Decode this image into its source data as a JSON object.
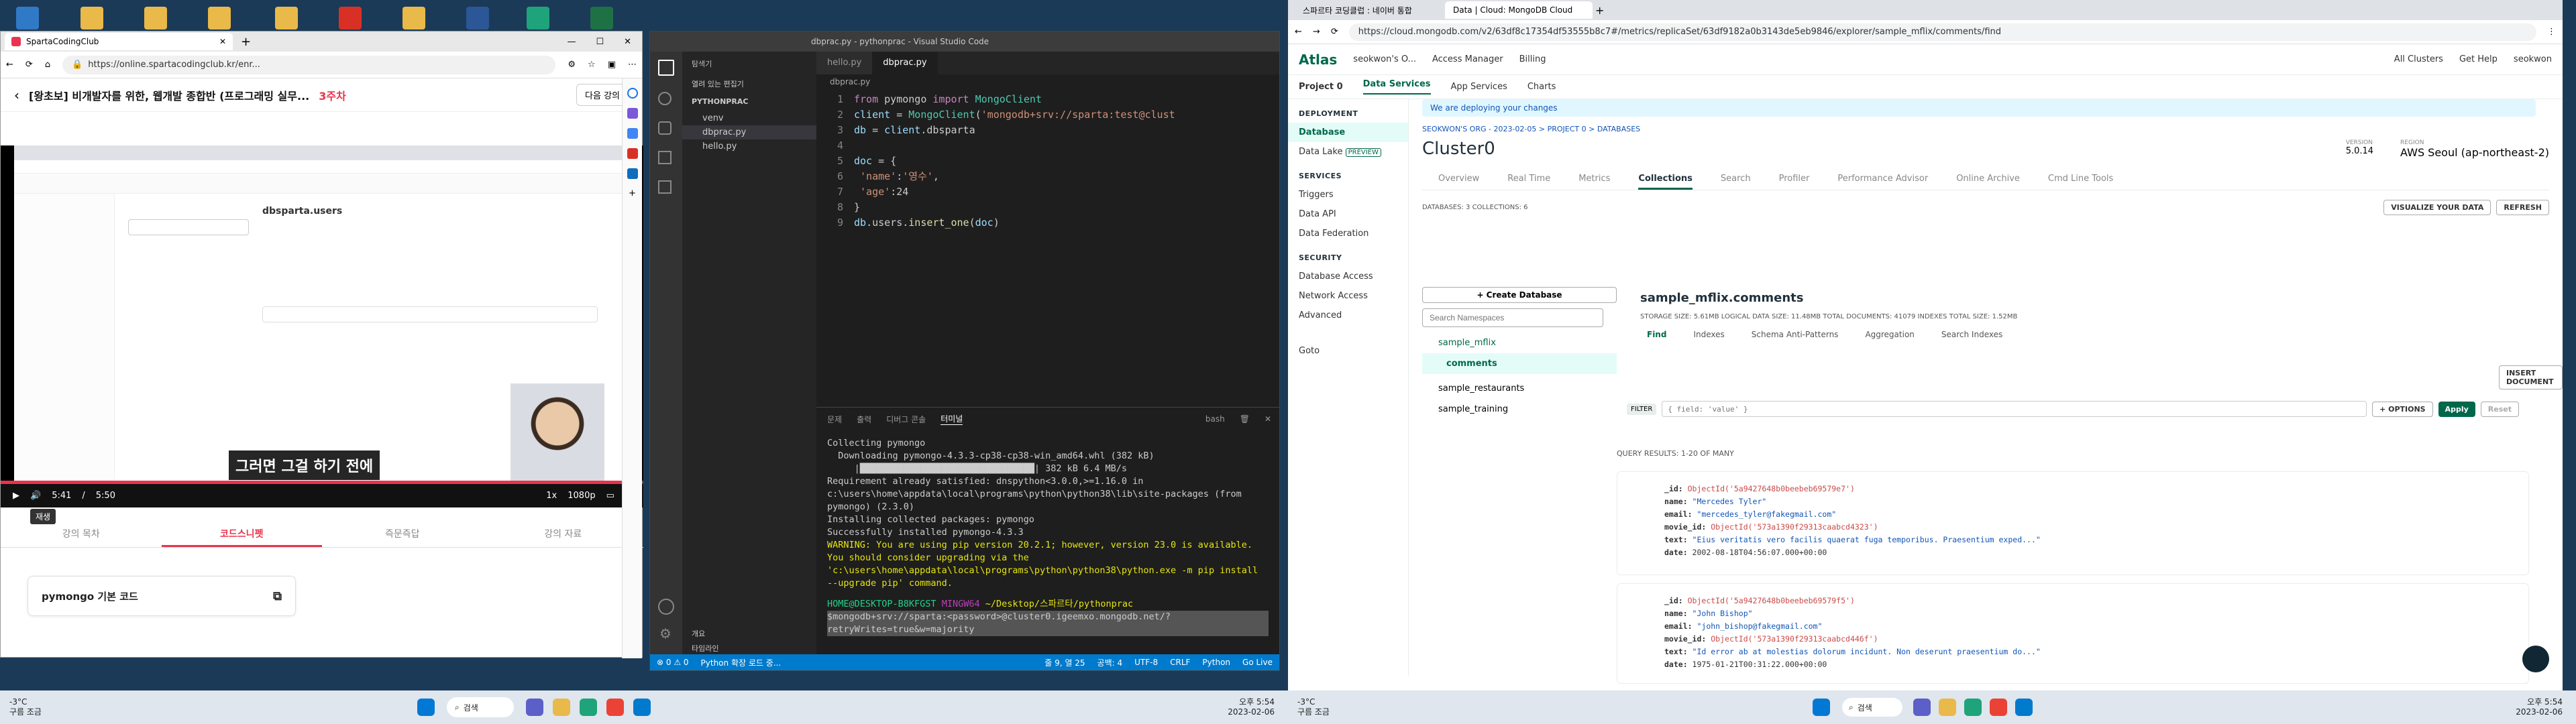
{
  "edge": {
    "tab_title": "SpartaCodingClub",
    "url": "https://online.spartacodingclub.kr/enr...",
    "lesson_title": "[왕초보] 비개발자를 위한, 웹개발 종합반 (프로그래밍 실무...",
    "lesson_week": "3주차",
    "next_lesson": "다음 강의",
    "subtitle": "그러면 그걸 하기 전에",
    "time_current": "5:41",
    "time_sep": "/",
    "time_total": "5:50",
    "speed": "1x",
    "quality": "1080p",
    "play_tooltip": "재생",
    "progress": 0.974,
    "lesson_tabs": [
      "강의 목차",
      "코드스니펫",
      "즉문즉답",
      "강의 자료"
    ],
    "snippet_title": "pymongo 기본 코드"
  },
  "vscode": {
    "title": "dbprac.py - pythonprac - Visual Studio Code",
    "explorer_label": "탐색기",
    "open_editors": "열려 있는 편집기",
    "project": "PYTHONPRAC",
    "files": [
      "venv",
      "dbprac.py",
      "hello.py"
    ],
    "outline": "개요",
    "timeline": "타임라인",
    "editor_tabs": [
      "hello.py",
      "dbprac.py"
    ],
    "breadcrumb": "dbprac.py",
    "code_lines": [
      "from pymongo import MongoClient",
      "client = MongoClient('mongodb+srv://sparta:test@clust",
      "db = client.dbsparta",
      "",
      "doc = {",
      "    'name':'영수',",
      "    'age':24",
      "}",
      "db.users.insert_one(doc)"
    ],
    "panel_tabs": [
      "문제",
      "출력",
      "디버그 콘솔",
      "터미널"
    ],
    "shell": "bash",
    "terminal": [
      "Collecting pymongo",
      "  Downloading pymongo-4.3.3-cp38-cp38-win_amd64.whl (382 kB)",
      "     |████████████████████████████████| 382 kB 6.4 MB/s",
      "Requirement already satisfied: dnspython<3.0.0,>=1.16.0 in c:\\users\\home\\appdata\\local\\programs\\python\\python38\\lib\\site-packages (from pymongo) (2.3.0)",
      "Installing collected packages: pymongo",
      "Successfully installed pymongo-4.3.3",
      "WARNING: You are using pip version 20.2.1; however, version 23.0 is available.",
      "You should consider upgrading via the 'c:\\users\\home\\appdata\\local\\programs\\python\\python38\\python.exe -m pip install --upgrade pip' command."
    ],
    "prompt_user": "HOME@DESKTOP-B8KFGST",
    "prompt_env": "MINGW64",
    "prompt_path": "~/Desktop/스파르타/pythonprac",
    "prompt_cmd": "$mongodb+srv://sparta:<password>@cluster0.igeemxo.mongodb.net/?retryWrites=true&w=majority",
    "status_left": "⊗ 0 ⚠ 0",
    "status_python": "Python 확장 로드 중...",
    "status_pos": "줄 9, 열 25",
    "status_spaces": "공백: 4",
    "status_enc": "UTF-8",
    "status_eol": "CRLF",
    "status_lang": "Python",
    "status_live": "Go Live"
  },
  "mongo": {
    "tab1": "스파르타 코딩클럽 : 네이버 통합",
    "tab2": "Data | Cloud: MongoDB Cloud",
    "url": "https://cloud.mongodb.com/v2/63df8c17354df53555b8c7#/metrics/replicaSet/63df9182a0b3143de5eb9846/explorer/sample_mflix/comments/find",
    "brand": "Atlas",
    "org": "seokwon's O...",
    "access_manager": "Access Manager",
    "billing": "Billing",
    "all_clusters": "All Clusters",
    "get_help": "Get Help",
    "user": "seokwon",
    "project": "Project 0",
    "subnav": [
      "Data Services",
      "App Services",
      "Charts"
    ],
    "left_sections": [
      {
        "head": "DEPLOYMENT",
        "items": [
          "Database",
          "Data Lake"
        ]
      },
      {
        "head": "SERVICES",
        "items": [
          "Triggers",
          "Data API",
          "Data Federation"
        ]
      },
      {
        "head": "SECURITY",
        "items": [
          "Database Access",
          "Network Access",
          "Advanced"
        ]
      }
    ],
    "preview_badge": "PREVIEW",
    "goto": "Goto",
    "banner": "We are deploying your changes",
    "breadcrumb": "SEOKWON'S ORG - 2023-02-05 > PROJECT 0 > DATABASES",
    "cluster": "Cluster0",
    "version_label": "VERSION",
    "version": "5.0.14",
    "region_label": "REGION",
    "region": "AWS Seoul (ap-northeast-2)",
    "cluster_tabs": [
      "Overview",
      "Real Time",
      "Metrics",
      "Collections",
      "Search",
      "Profiler",
      "Performance Advisor",
      "Online Archive",
      "Cmd Line Tools"
    ],
    "db_count": "DATABASES: 3  COLLECTIONS: 6",
    "visualize": "VISUALIZE YOUR DATA",
    "refresh": "REFRESH",
    "create_db": "+ Create Database",
    "search_ns": "Search Namespaces",
    "tree": [
      "sample_mflix",
      "comments",
      "sample_restaurants",
      "sample_training"
    ],
    "collection": "sample_mflix.comments",
    "stats": "STORAGE SIZE: 5.61MB    LOGICAL DATA SIZE: 11.48MB    TOTAL DOCUMENTS: 41079    INDEXES TOTAL SIZE: 1.52MB",
    "coll_tabs": [
      "Find",
      "Indexes",
      "Schema Anti-Patterns",
      "Aggregation",
      "Search Indexes"
    ],
    "insert_doc": "INSERT DOCUMENT",
    "filter_label": "FILTER",
    "filter_placeholder": "{ field: 'value' }",
    "options": "+ OPTIONS",
    "apply": "Apply",
    "reset": "Reset",
    "results": "QUERY RESULTS: 1-20 OF MANY",
    "docs": [
      {
        "id": "ObjectId('5a9427648b0beebeb69579e7')",
        "name": "\"Mercedes Tyler\"",
        "email": "\"mercedes_tyler@fakegmail.com\"",
        "movie_id": "ObjectId('573a1390f29313caabcd4323')",
        "text": "\"Eius veritatis vero facilis quaerat fuga temporibus. Praesentium exped...\"",
        "date": "2002-08-18T04:56:07.000+00:00"
      },
      {
        "id": "ObjectId('5a9427648b0beebeb69579f5')",
        "name": "\"John Bishop\"",
        "email": "\"john_bishop@fakegmail.com\"",
        "movie_id": "ObjectId('573a1390f29313caabcd446f')",
        "text": "\"Id error ab at molestias dolorum incidunt. Non deserunt praesentium do...\"",
        "date": "1975-01-21T00:31:22.000+00:00"
      }
    ]
  },
  "taskbar_left": {
    "temp": "-3°C",
    "weather": "구름 조금",
    "search": "검색",
    "time": "오후 5:54",
    "date": "2023-02-06"
  },
  "taskbar_right": {
    "temp": "-3°C",
    "weather": "구름 조금",
    "search": "검색",
    "time": "오후 5:54",
    "date": "2023-02-06"
  }
}
